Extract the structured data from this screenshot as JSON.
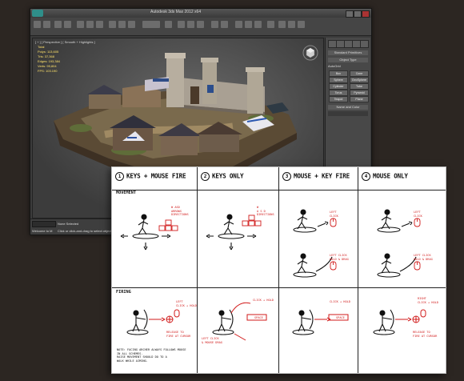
{
  "max_window": {
    "title": "Autodesk 3ds Max 2012 x64",
    "viewport_label": "[ + ] [ Perspective ] [ Smooth + Highlights ]",
    "stats": [
      "Total",
      "Polys: 113,605",
      "Tris: 37,368",
      "Edges: 193,384",
      "Verts: 99,804",
      "",
      "FPS: 103.190"
    ],
    "command_panel": {
      "rollout_top": "Standard Primitives",
      "rollout_object_type": "Object Type",
      "autogrid": "AutoGrid",
      "buttons": [
        "Box",
        "Cone",
        "Sphere",
        "GeoSphere",
        "Cylinder",
        "Tube",
        "Torus",
        "Pyramid",
        "Teapot",
        "Plane"
      ],
      "rollout_name_color": "Name and Color"
    },
    "status": {
      "selection": "None Selected",
      "prompt": "Click or click-and-drag to select objects",
      "welcome": "Welcome to M"
    },
    "accent_color": "#2f8f8a"
  },
  "storyboard": {
    "columns": [
      {
        "number": "1",
        "title": "KEYS + MOUSE FIRE"
      },
      {
        "number": "2",
        "title": "KEYS ONLY"
      },
      {
        "number": "3",
        "title": "MOUSE + KEY FIRE"
      },
      {
        "number": "4",
        "title": "MOUSE ONLY"
      }
    ],
    "sections": {
      "movement": "MOVEMENT",
      "firing": "FIRING"
    },
    "movement_notes": {
      "col1": [
        "W ASD",
        "ARROWS",
        "DIRECTIONS"
      ],
      "col2": [
        "W",
        "A S D",
        "DIRECTIONS"
      ],
      "col3": [
        "LEFT",
        "CLICK"
      ],
      "col3b": [
        "LEFT CLICK",
        "HOLD & DRAG"
      ],
      "col4": [
        "LEFT",
        "CLICK"
      ],
      "col4b": [
        "LEFT CLICK",
        "HOLD & DRAG"
      ]
    },
    "firing_notes": {
      "col1": [
        "LEFT",
        "CLICK + HOLD"
      ],
      "col1_release": [
        "RELEASE TO",
        "FIRE AT CURSOR"
      ],
      "col1_footer": [
        "NOTE: FACING ARCHER ALWAYS FOLLOWS MOUSE",
        "IN ALL SCHEMES.",
        "RAISE MOVEMENT SHOULD DO TO A",
        "WALK WHILE AIMING."
      ],
      "col2": [
        "CLICK + HOLD"
      ],
      "col2_key": "SPACE",
      "col2_left": [
        "LEFT CLICK",
        "& MOUSE DRAG"
      ],
      "col3": [
        "CLICK + HOLD"
      ],
      "col3_key": "SPACE",
      "col4": [
        "RIGHT",
        "CLICK + HOLD"
      ],
      "col4_release": [
        "RELEASE TO",
        "FIRE AT CURSOR"
      ]
    },
    "ink_color": "#111111",
    "annotation_color": "#d11a1a"
  }
}
